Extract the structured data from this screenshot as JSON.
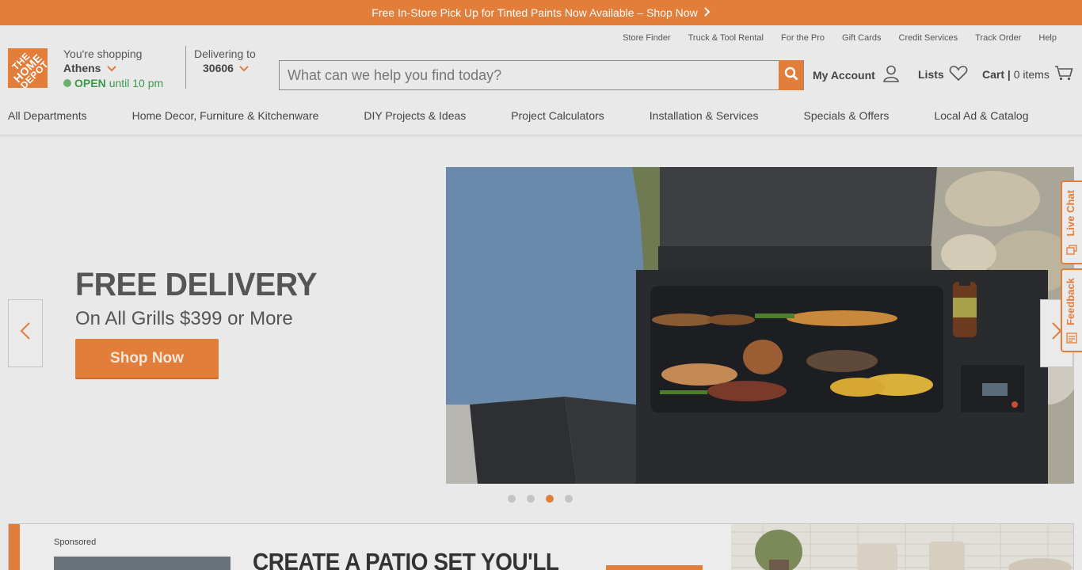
{
  "banner": {
    "text": "Free In-Store Pick Up for Tinted Paints Now Available – Shop Now"
  },
  "logo": {
    "line1": "THE",
    "line2": "HOME",
    "line3": "DEPOT"
  },
  "store": {
    "label": "You're shopping",
    "city": "Athens",
    "status": "OPEN",
    "hours": "until 10 pm"
  },
  "delivery": {
    "label": "Delivering to",
    "zip": "30606"
  },
  "util_links": [
    "Store Finder",
    "Truck & Tool Rental",
    "For the Pro",
    "Gift Cards",
    "Credit Services",
    "Track Order",
    "Help"
  ],
  "search": {
    "placeholder": "What can we help you find today?"
  },
  "account": {
    "label": "My Account"
  },
  "lists": {
    "label": "Lists"
  },
  "cart": {
    "label": "Cart |",
    "count": "0 items"
  },
  "nav": [
    "All Departments",
    "Home Decor, Furniture & Kitchenware",
    "DIY Projects & Ideas",
    "Project Calculators",
    "Installation & Services",
    "Specials & Offers",
    "Local Ad & Catalog"
  ],
  "hero": {
    "title": "FREE DELIVERY",
    "subtitle": "On All Grills $399 or More",
    "button": "Shop Now",
    "slide_count": 4,
    "active_slide": 3
  },
  "side_tabs": {
    "live_chat": "Live Chat",
    "feedback": "Feedback"
  },
  "promo": {
    "sponsored": "Sponsored",
    "heading": "CREATE A PATIO SET YOU'LL"
  },
  "colors": {
    "brand_orange": "#e27d3a",
    "open_green": "#3a9a4a"
  }
}
